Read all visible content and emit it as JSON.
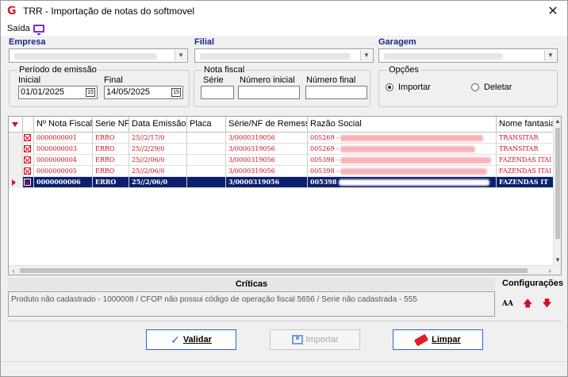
{
  "window": {
    "title": "TRR - Importação de notas do softmovel",
    "close_glyph": "✕",
    "app_icon_glyph": "G"
  },
  "menu": {
    "exit_label": "Saída"
  },
  "filters": {
    "empresa_label": "Empresa",
    "filial_label": "Filial",
    "garagem_label": "Garagem",
    "periodo": {
      "legend": "Período de emissão",
      "inicial_label": "Inicial",
      "inicial_value": "01/01/2025",
      "final_label": "Final",
      "final_value": "14/05/2025"
    },
    "nota_fiscal": {
      "legend": "Nota fiscal",
      "serie_label": "Série",
      "numero_inicial_label": "Número inicial",
      "numero_final_label": "Número final"
    },
    "opcoes": {
      "legend": "Opções",
      "importar_label": "Importar",
      "deletar_label": "Deletar",
      "selected": "Importar"
    }
  },
  "grid": {
    "columns": [
      "Nº Nota Fiscal",
      "Serie NF",
      "Data Emissão",
      "Placa",
      "Série/NF de Remessa",
      "Razão Social",
      "Nome fantasia"
    ],
    "rows": [
      {
        "nota": "0000000001",
        "serie": "ERRO",
        "data": "25//2/17/0",
        "placa": "",
        "remessa": "3/0000319056",
        "razao": "005269 -",
        "fantasia": "TRANSITAR"
      },
      {
        "nota": "0000000003",
        "serie": "ERRO",
        "data": "25//2/29/0",
        "placa": "",
        "remessa": "3/0000319056",
        "razao": "005269 -",
        "fantasia": "TRANSITAR"
      },
      {
        "nota": "0000000004",
        "serie": "ERRO",
        "data": "25//2/06/0",
        "placa": "",
        "remessa": "3/0000319056",
        "razao": "005398 -",
        "fantasia": "FAZENDAS ITAI"
      },
      {
        "nota": "0000000005",
        "serie": "ERRO",
        "data": "25//2/06/0",
        "placa": "",
        "remessa": "3/0000319056",
        "razao": "005398 -",
        "fantasia": "FAZENDAS ITAI"
      },
      {
        "nota": "0000000006",
        "serie": "ERRO",
        "data": "25//2/06/0",
        "placa": "",
        "remessa": "3/0000319056",
        "razao": "005398",
        "fantasia": "FAZENDAS IT"
      }
    ],
    "selected_row": 4
  },
  "criticas": {
    "title": "Críticas",
    "message": "Produto não cadastrado - 1000008 / CFOP não possui código de operação fiscal 5656  / Serie não cadastrada - 555"
  },
  "config": {
    "title": "Configurações",
    "font_tool": "AA"
  },
  "buttons": {
    "validar": "Validar",
    "importar": "Importar",
    "limpar": "Limpar"
  },
  "colors": {
    "accent": "#2f66d6",
    "error": "#d01020",
    "selection": "#0a1f6e"
  }
}
